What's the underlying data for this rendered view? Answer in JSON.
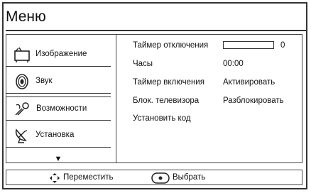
{
  "menu_title": "Меню",
  "menu_items": [
    {
      "label": "Изображение",
      "icon": "tv-icon"
    },
    {
      "label": "Звук",
      "icon": "speaker-icon"
    },
    {
      "label": "Возможности",
      "icon": "features-icon"
    },
    {
      "label": "Установка",
      "icon": "satellite-dish-icon"
    }
  ],
  "down_arrow": "▼",
  "settings": [
    {
      "label": "Таймер отключения",
      "value": "0"
    },
    {
      "label": "Часы",
      "value": "00:00"
    },
    {
      "label": "Таймер включения",
      "value": "Активировать"
    },
    {
      "label": "Блок. телевизора",
      "value": "Разблокировать"
    },
    {
      "label": "Установить код",
      "value": ""
    }
  ],
  "sleep_timer_level": 0,
  "footer": {
    "move_label": "Переместить",
    "select_label": "Выбрать"
  }
}
